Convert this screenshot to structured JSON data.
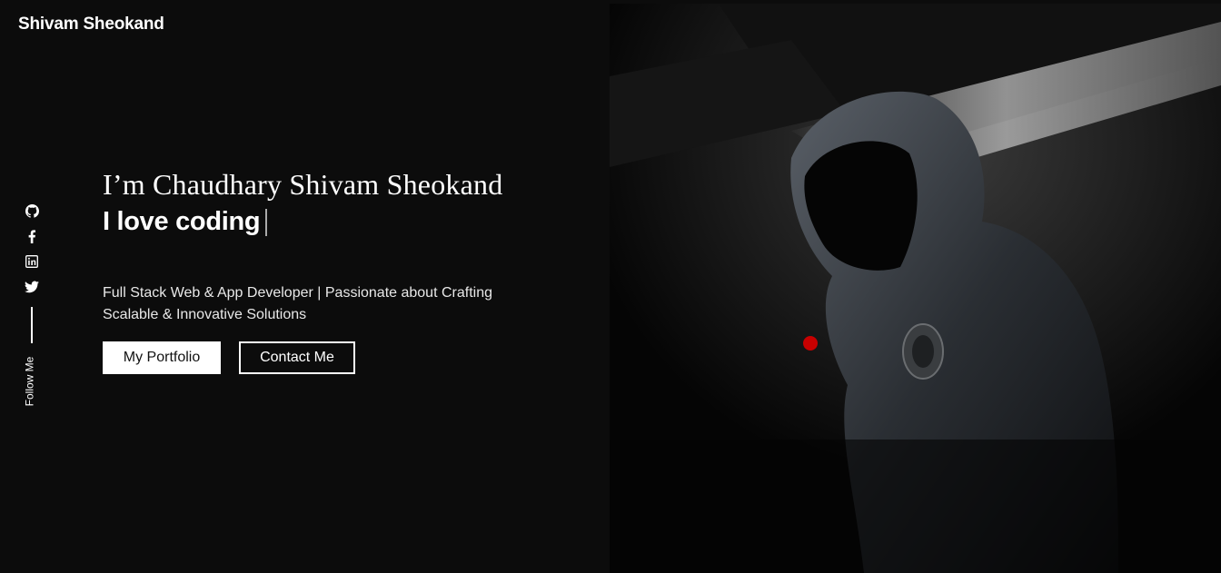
{
  "header": {
    "logo": "Shivam Sheokand",
    "theme_toggle_icon": "contrast-icon",
    "menu_icon": "hamburger-menu-icon"
  },
  "social": {
    "items": [
      {
        "icon": "github-icon"
      },
      {
        "icon": "facebook-icon"
      },
      {
        "icon": "linkedin-icon"
      },
      {
        "icon": "twitter-icon"
      }
    ],
    "label": "Follow Me"
  },
  "hero": {
    "title": "I’m Chaudhary Shivam Sheokand",
    "typed_text": "I love coding",
    "description": "Full Stack Web & App Developer | Passionate about Crafting Scalable & Innovative Solutions",
    "primary_button": "My Portfolio",
    "secondary_button": "Contact Me"
  },
  "colors": {
    "background": "#0c0c0c",
    "accent_dot": "#c80000"
  }
}
